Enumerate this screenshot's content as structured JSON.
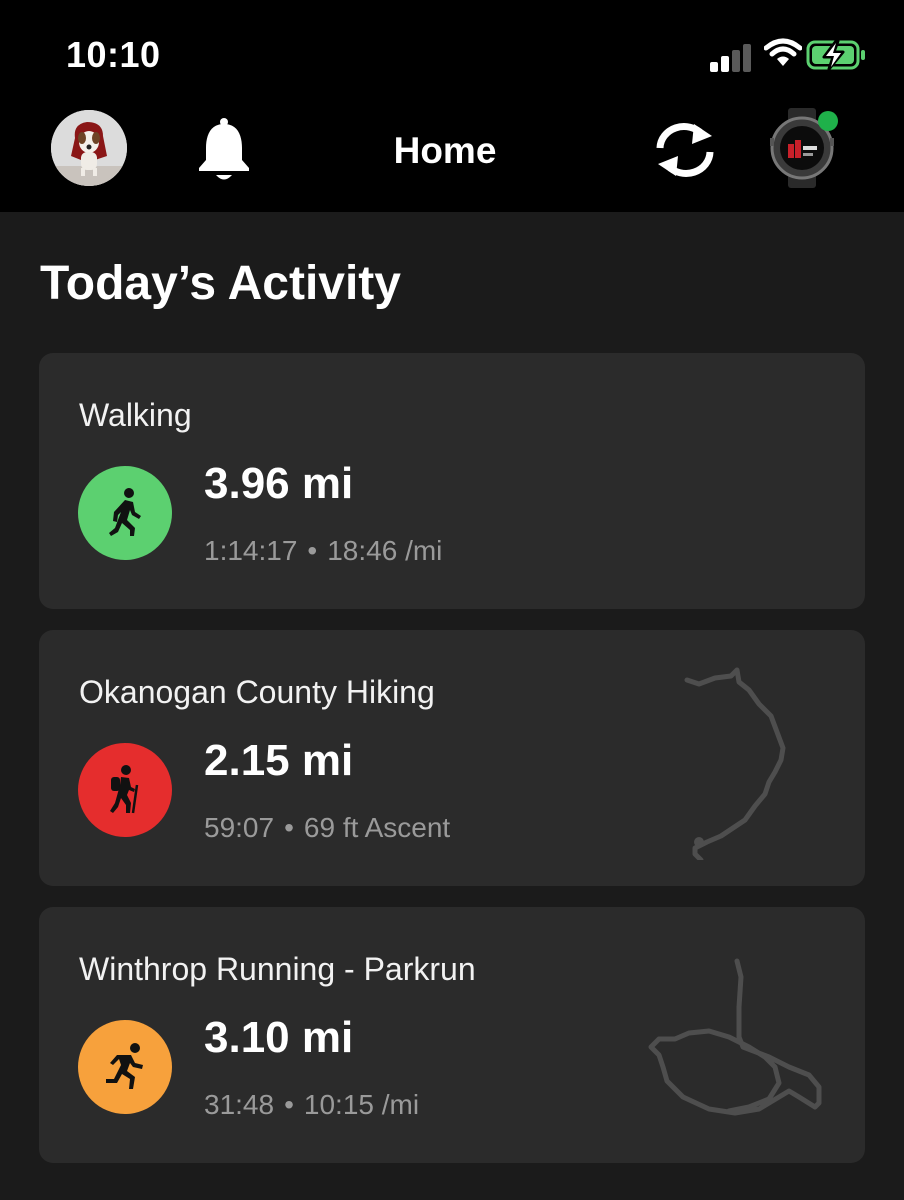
{
  "status_bar": {
    "time": "10:10"
  },
  "nav": {
    "title": "Home",
    "icons": [
      "avatar",
      "bell-icon",
      "sync-icon",
      "watch-device"
    ],
    "device_connected_color": "#1fb14a"
  },
  "section": {
    "title": "Today’s Activity"
  },
  "activities": [
    {
      "title": "Walking",
      "distance": "3.96 mi",
      "duration": "1:14:17",
      "separator": "•",
      "detail": "18:46 /mi",
      "icon": "walking-icon",
      "color": "#5cd070"
    },
    {
      "title": "Okanogan County Hiking",
      "distance": "2.15 mi",
      "duration": "59:07",
      "separator": "•",
      "detail": "69 ft Ascent",
      "icon": "hiking-icon",
      "color": "#e52d2d"
    },
    {
      "title": "Winthrop Running - Parkrun",
      "distance": "3.10 mi",
      "duration": "31:48",
      "separator": "•",
      "detail": "10:15 /mi",
      "icon": "running-icon",
      "color": "#f7a13c"
    }
  ]
}
